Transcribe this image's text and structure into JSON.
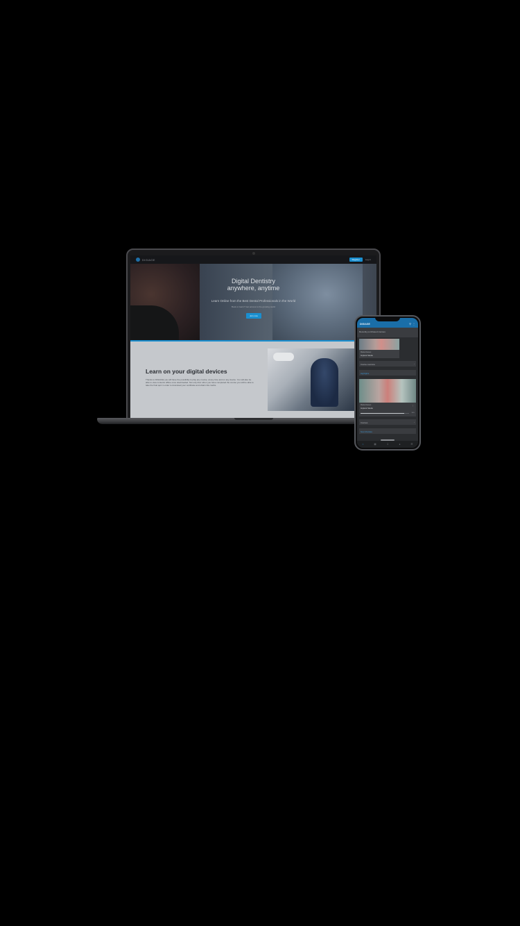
{
  "laptop": {
    "nav": {
      "logo": "DIGIAGE",
      "primary_button": "Register",
      "link": "Log in"
    },
    "hero": {
      "title_line1": "Digital Dentistry",
      "title_line2": "anywhere, anytime",
      "subtitle": "Learn Online from the Best Dental Professionals in the World",
      "small_text": "Book or learn? Get access to the growing world",
      "cta": "Join now"
    },
    "section": {
      "title": "Learn on your digital devices",
      "body": "Thanks to DIGIAGE you will have the possibility to play any course, at any time and on any device. You will also be able to view contents offline once downloaded. Not only that: when you have completed the course you will be able to take the final quiz in order to download your certificate and obtain CE credits."
    }
  },
  "phone": {
    "header_title": "DIGIAGE",
    "section_head": "Recently purchased courses",
    "card1": {
      "category": "Masterclasses",
      "name": "Implant Studio"
    },
    "rows": [
      {
        "label": "Course overview"
      },
      {
        "label": "Highlights"
      }
    ],
    "card2": {
      "category": "Masterclasses",
      "name": "Implant Studio",
      "progress_pct": 90,
      "progress_label": "90%"
    },
    "rows2": [
      {
        "label": "Courses"
      },
      {
        "label": "New Modules"
      }
    ]
  },
  "icons": {
    "search": "search-icon",
    "menu": "more-vertical-icon",
    "chevron": "chevron-right-icon"
  },
  "colors": {
    "accent": "#1a8fd0",
    "phone_header": "#1a6ea8"
  }
}
